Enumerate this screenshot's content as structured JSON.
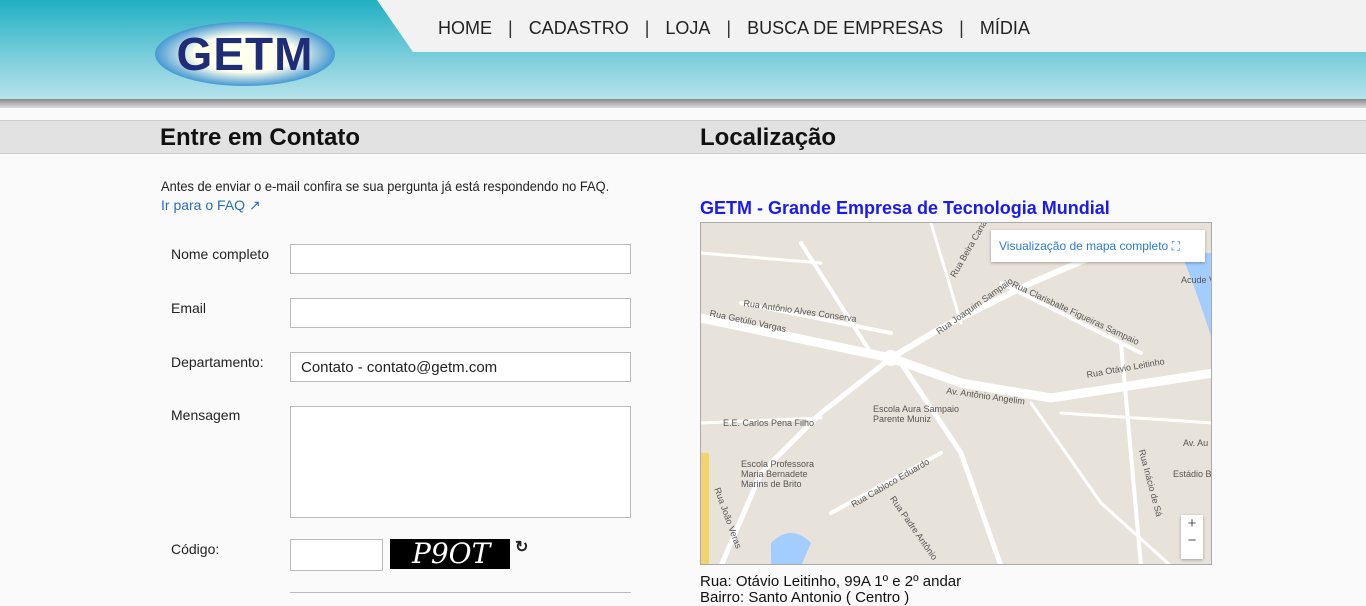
{
  "header": {
    "logo_text": "GETM",
    "nav": [
      "HOME",
      "CADASTRO",
      "LOJA",
      "BUSCA DE EMPRESAS",
      "MÍDIA"
    ]
  },
  "contact": {
    "title": "Entre em Contato",
    "intro": "Antes de enviar o e-mail confira se sua pergunta já está respondendo no FAQ.",
    "faq_link": "Ir para o FAQ",
    "fields": {
      "name_label": "Nome completo",
      "email_label": "Email",
      "dept_label": "Departamento:",
      "dept_value": "Contato - contato@getm.com",
      "message_label": "Mensagem",
      "code_label": "Código:",
      "captcha_text": "P9OT"
    }
  },
  "location": {
    "title": "Localização",
    "company": "GETM - Grande Empresa de Tecnologia Mundial",
    "map_fullview": "Visualização de mapa completo",
    "map_labels": [
      "Rua Getúlio Vargas",
      "Rua Antônio Alves Conserva",
      "Rua Joaquim Sampaio",
      "Rua Clarisbalte Figueiras Sampaio",
      "Rua Otávio Leitinho",
      "Av. Antônio Angelim",
      "Escola Aura Sampaio Parente Muniz",
      "E.E. Carlos Pena Filho",
      "Escola Professora Maria Bernadete Marins de Brito",
      "Rua Cabloco Eduardo",
      "Rua Padre Antônio",
      "Rua João Veras",
      "Rua Inácio de Sá",
      "Estádio Barros Mu",
      "Av. Au",
      "Acude V",
      "Rua Beira Canal"
    ],
    "address_line1": "Rua: Otávio Leitinho, 99A 1º e 2º andar",
    "address_line2": "Bairro: Santo Antonio ( Centro )"
  }
}
